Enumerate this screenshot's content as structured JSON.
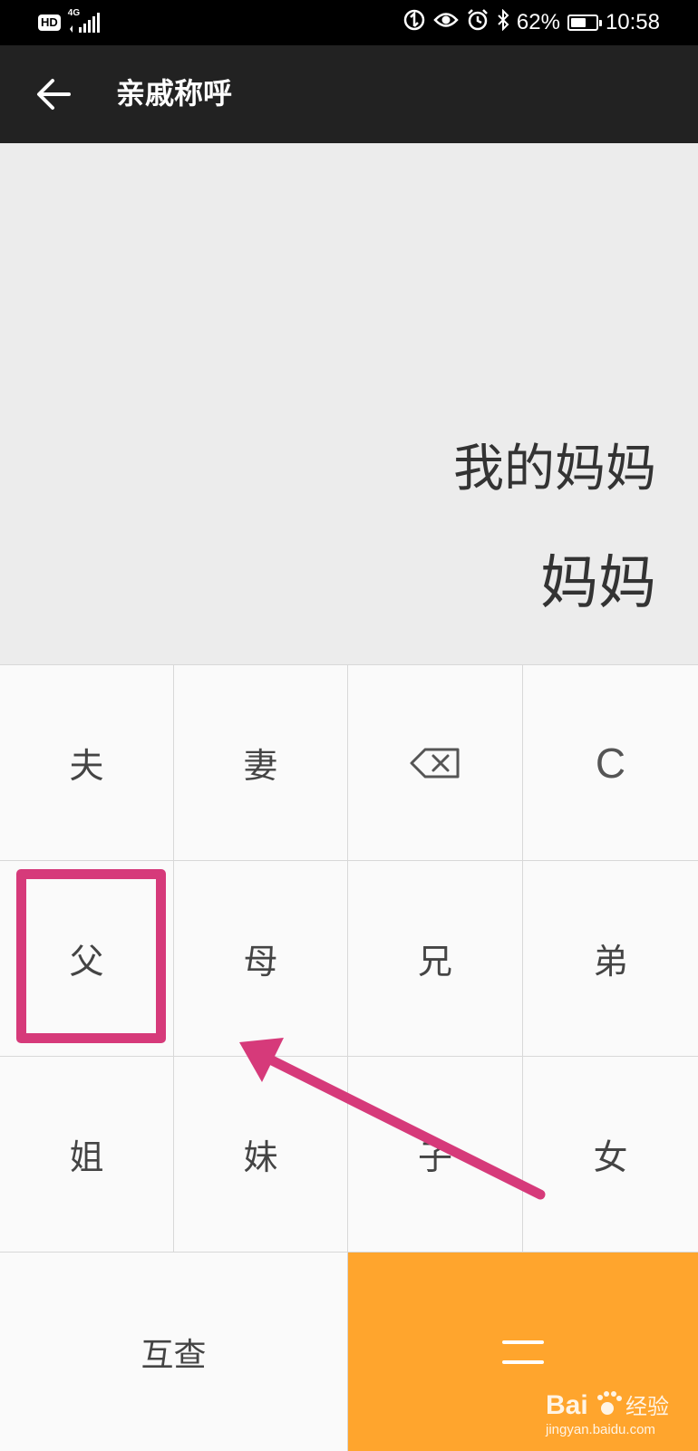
{
  "status_bar": {
    "hd_label": "HD",
    "network_label": "4G",
    "battery_text": "62%",
    "battery_level": 0.62,
    "time": "10:58",
    "icons": [
      "hd-icon",
      "signal-icon",
      "data-saver-icon",
      "eye-comfort-icon",
      "alarm-icon",
      "bluetooth-icon",
      "battery-icon"
    ]
  },
  "app_bar": {
    "back_icon": "arrow-left-icon",
    "title": "亲戚称呼"
  },
  "display": {
    "expression": "我的妈妈",
    "result": "妈妈"
  },
  "keypad": {
    "rows": [
      [
        "夫",
        "妻",
        "⌫",
        "C"
      ],
      [
        "父",
        "母",
        "兄",
        "弟"
      ],
      [
        "姐",
        "妹",
        "子",
        "女"
      ]
    ],
    "keys": {
      "husband": "夫",
      "wife": "妻",
      "backspace_icon": "backspace-icon",
      "clear": "C",
      "father": "父",
      "mother": "母",
      "elder_brother": "兄",
      "younger_brother": "弟",
      "elder_sister": "姐",
      "younger_sister": "妹",
      "son": "子",
      "daughter": "女"
    },
    "lookup_label": "互查",
    "equals_label": "=",
    "equals_color": "#ffa52d"
  },
  "annotation": {
    "color": "#d63a7a"
  },
  "watermark": {
    "logo_text": "Bai",
    "logo_suffix": "经验",
    "url": "jingyan.baidu.com"
  }
}
